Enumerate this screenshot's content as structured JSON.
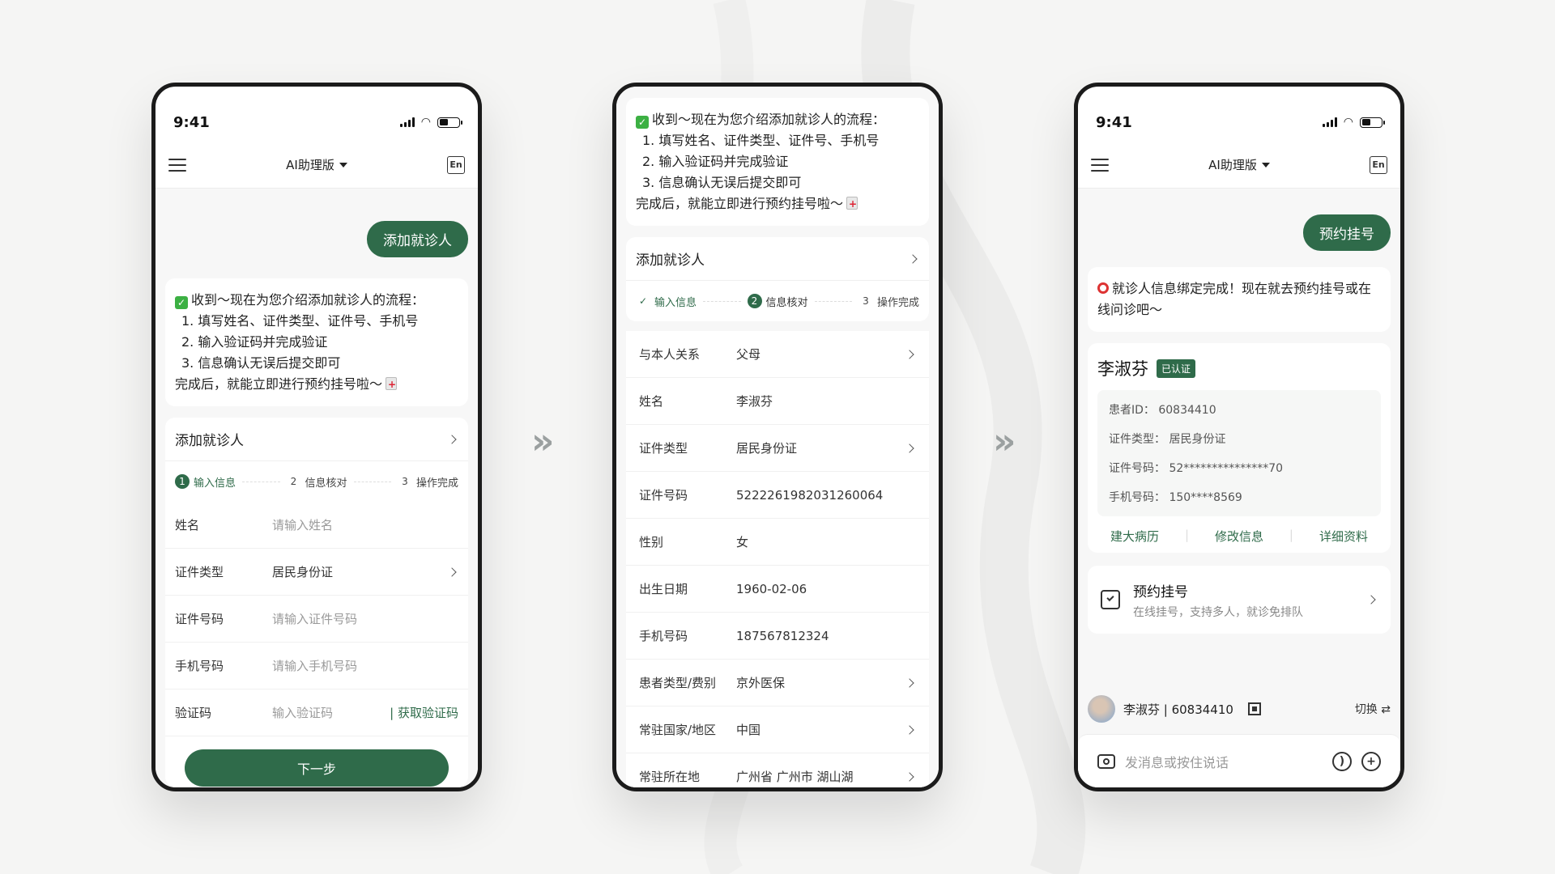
{
  "status": {
    "time": "9:41"
  },
  "nav": {
    "title": "AI助理版",
    "en_label": "En"
  },
  "phone1": {
    "user_msg": "添加就诊人",
    "bot": {
      "intro": "收到～现在为您介绍添加就诊人的流程：",
      "steps": [
        "1. 填写姓名、证件类型、证件号、手机号",
        "2. 输入验证码并完成验证",
        "3. 信息确认无误后提交即可"
      ],
      "outro": "完成后，就能立即进行预约挂号啦～"
    },
    "form": {
      "title": "添加就诊人",
      "steps": [
        {
          "n": "1",
          "label": "输入信息"
        },
        {
          "n": "2",
          "label": "信息核对"
        },
        {
          "n": "3",
          "label": "操作完成"
        }
      ],
      "rows": [
        {
          "label": "姓名",
          "value": "请输入姓名"
        },
        {
          "label": "证件类型",
          "value": "居民身份证"
        },
        {
          "label": "证件号码",
          "value": "请输入证件号码"
        },
        {
          "label": "手机号码",
          "value": "请输入手机号码"
        },
        {
          "label": "验证码",
          "value": "输入验证码",
          "action": "获取验证码"
        }
      ],
      "next_label": "下一步"
    }
  },
  "phone2": {
    "bot": {
      "intro": "收到～现在为您介绍添加就诊人的流程：",
      "steps": [
        "1. 填写姓名、证件类型、证件号、手机号",
        "2. 输入验证码并完成验证",
        "3. 信息确认无误后提交即可"
      ],
      "outro": "完成后，就能立即进行预约挂号啦～"
    },
    "form": {
      "title": "添加就诊人",
      "steps": [
        {
          "n": "✓",
          "label": "输入信息"
        },
        {
          "n": "2",
          "label": "信息核对"
        },
        {
          "n": "3",
          "label": "操作完成"
        }
      ],
      "rows": [
        {
          "label": "与本人关系",
          "value": "父母"
        },
        {
          "label": "姓名",
          "value": "李淑芬"
        },
        {
          "label": "证件类型",
          "value": "居民身份证"
        },
        {
          "label": "证件号码",
          "value": "522226198203126006​4"
        },
        {
          "label": "性别",
          "value": "女"
        },
        {
          "label": "出生日期",
          "value": "1960-02-06"
        },
        {
          "label": "手机号码",
          "value": "187567812324"
        },
        {
          "label": "患者类型/费别",
          "value": "京外医保"
        },
        {
          "label": "常驻国家/地区",
          "value": "中国"
        },
        {
          "label": "常驻所在地",
          "value": "广州省 广州市 湖山湖"
        }
      ]
    }
  },
  "phone3": {
    "user_msg": "预约挂号",
    "notice": "就诊人信息绑定完成！现在就去预约挂号或在线问诊吧～",
    "patient": {
      "name": "李淑芬",
      "badge": "已认证",
      "info": [
        "患者ID： 60834410",
        "证件类型： 居民身份证",
        "证件号码： 52***************70",
        "手机号码： 150****8569"
      ],
      "actions": [
        "建大病历",
        "修改信息",
        "详细资料"
      ]
    },
    "appointment": {
      "title": "预约挂号",
      "sub": "在线挂号，支持多人，就诊免排队"
    },
    "current_patient": "李淑芬 | 60834410",
    "switch_label": "切换 ⇄",
    "input_placeholder": "发消息或按住说话"
  }
}
